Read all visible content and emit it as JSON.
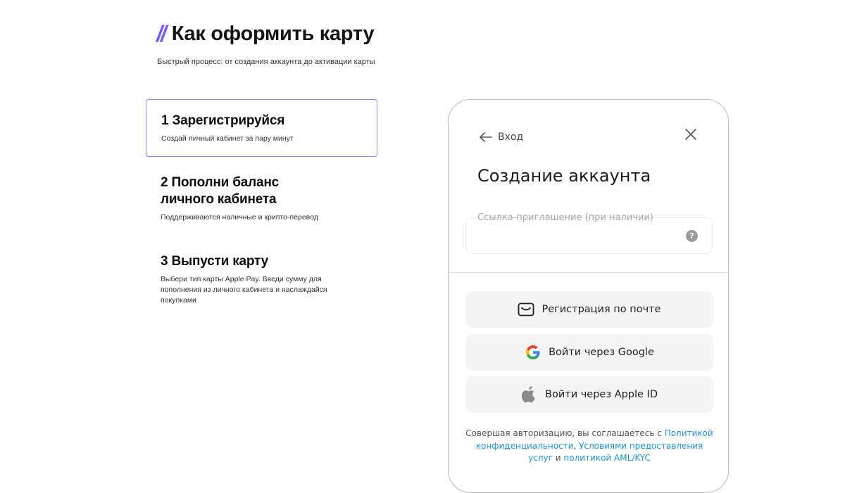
{
  "header": {
    "slashes": "//",
    "title": "Как оформить карту",
    "subtitle": "Быстрый процесс: от создания аккаунта до активации карты"
  },
  "steps": [
    {
      "title": "1 Зарегистрируйся",
      "desc": "Создай личный кабинет за пару минут",
      "active": true
    },
    {
      "title": "2 Пополни баланс личного кабинета",
      "desc": "Поддерживаются наличные и крипто-перевод"
    },
    {
      "title": "3 Выпусти карту",
      "desc": "Выбери тип карты Apple Pay. Введи сумму для пополнения из личного кабинета и наслаждайся покупками"
    }
  ],
  "phone": {
    "back_label": "Вход",
    "title": "Создание аккаунта",
    "invite_label": "Ссылка-приглашение (при наличии)",
    "invite_value": "",
    "help_glyph": "?",
    "buttons": {
      "email": "Регистрация по почте",
      "google": "Войти через Google",
      "apple": "Войти через Apple ID"
    },
    "terms": {
      "prefix": "Совершая авторизацию, вы соглашаетесь с ",
      "privacy_link": "Политикой конфиденциальности",
      "sep": ", ",
      "services_link": "Условиями предоставления услуг",
      "and": " и ",
      "aml_link": "политикой AML/KYC"
    }
  },
  "colors": {
    "accent": "#7b5cf2",
    "active_border": "#8e7cf5",
    "link": "#2196d3",
    "button_bg": "#f4f4f4"
  },
  "icons": [
    "arrow-left-icon",
    "close-icon",
    "help-icon",
    "mail-icon",
    "google-icon",
    "apple-icon"
  ]
}
